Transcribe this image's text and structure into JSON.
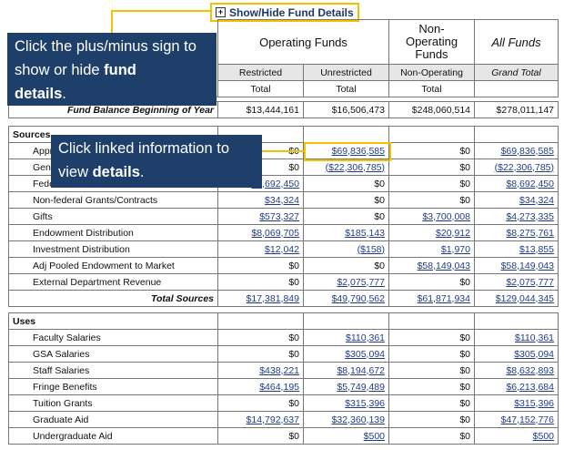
{
  "toggle": {
    "label": "Show/Hide Fund Details",
    "icon": "plus-box-icon"
  },
  "callouts": {
    "plusminus_pre": "Click the plus/minus sign to show or hide ",
    "plusminus_bold1": "fund",
    "plusminus_bold2": "details",
    "plusminus_post": ".",
    "linked_pre": "Click linked information to view ",
    "linked_bold": "details",
    "linked_post": "."
  },
  "header": {
    "operating": "Operating Funds",
    "non_operating": "Non-\nOperating\nFunds",
    "all_funds": "All Funds",
    "restricted": "Restricted",
    "unrestricted": "Unrestricted",
    "non_op_sub": "Non-Operating",
    "grand_total": "Grand Total",
    "total": "Total"
  },
  "fund_balance": {
    "label": "Fund Balance Beginning of Year",
    "values": [
      "$13,444,161",
      "$16,506,473",
      "$248,060,514",
      "$278,011,147"
    ]
  },
  "sources": {
    "title": "Sources",
    "rows": [
      {
        "label": "Appropriations",
        "values": [
          "$0",
          "$69,836,585",
          "$0",
          "$69,836,585"
        ],
        "links": [
          false,
          true,
          false,
          true
        ]
      },
      {
        "label": "General Funds",
        "values": [
          "$0",
          "($22,306,785)",
          "$0",
          "($22,306,785)"
        ],
        "links": [
          false,
          true,
          false,
          true
        ]
      },
      {
        "label": "Federal Grants/Contracts",
        "values": [
          "$8,692,450",
          "$0",
          "$0",
          "$8,692,450"
        ],
        "links": [
          true,
          false,
          false,
          true
        ]
      },
      {
        "label": "Non-federal Grants/Contracts",
        "values": [
          "$34,324",
          "$0",
          "$0",
          "$34,324"
        ],
        "links": [
          true,
          false,
          false,
          true
        ]
      },
      {
        "label": "Gifts",
        "values": [
          "$573,327",
          "$0",
          "$3,700,008",
          "$4,273,335"
        ],
        "links": [
          true,
          false,
          true,
          true
        ]
      },
      {
        "label": "Endowment Distribution",
        "values": [
          "$8,069,705",
          "$185,143",
          "$20,912",
          "$8,275,761"
        ],
        "links": [
          true,
          true,
          true,
          true
        ]
      },
      {
        "label": "Investment Distribution",
        "values": [
          "$12,042",
          "($158)",
          "$1,970",
          "$13,855"
        ],
        "links": [
          true,
          true,
          true,
          true
        ]
      },
      {
        "label": "Adj Pooled Endowment to Market",
        "values": [
          "$0",
          "$0",
          "$58,149,043",
          "$58,149,043"
        ],
        "links": [
          false,
          false,
          true,
          true
        ]
      },
      {
        "label": "External Department Revenue",
        "values": [
          "$0",
          "$2,075,777",
          "$0",
          "$2,075,777"
        ],
        "links": [
          false,
          true,
          false,
          true
        ]
      }
    ],
    "total": {
      "label": "Total Sources",
      "values": [
        "$17,381,849",
        "$49,790,562",
        "$61,871,934",
        "$129,044,345"
      ]
    }
  },
  "uses": {
    "title": "Uses",
    "rows": [
      {
        "label": "Faculty Salaries",
        "values": [
          "$0",
          "$110,361",
          "$0",
          "$110,361"
        ],
        "links": [
          false,
          true,
          false,
          true
        ]
      },
      {
        "label": "GSA Salaries",
        "values": [
          "$0",
          "$305,094",
          "$0",
          "$305,094"
        ],
        "links": [
          false,
          true,
          false,
          true
        ]
      },
      {
        "label": "Staff Salaries",
        "values": [
          "$438,221",
          "$8,194,672",
          "$0",
          "$8,632,893"
        ],
        "links": [
          true,
          true,
          false,
          true
        ]
      },
      {
        "label": "Fringe Benefits",
        "values": [
          "$464,195",
          "$5,749,489",
          "$0",
          "$6,213,684"
        ],
        "links": [
          true,
          true,
          false,
          true
        ]
      },
      {
        "label": "Tuition Grants",
        "values": [
          "$0",
          "$315,396",
          "$0",
          "$315,396"
        ],
        "links": [
          false,
          true,
          false,
          true
        ]
      },
      {
        "label": "Graduate Aid",
        "values": [
          "$14,792,637",
          "$32,360,139",
          "$0",
          "$47,152,776"
        ],
        "links": [
          true,
          true,
          false,
          true
        ]
      },
      {
        "label": "Undergraduate Aid",
        "values": [
          "$0",
          "$500",
          "$0",
          "$500"
        ],
        "links": [
          false,
          true,
          false,
          true
        ]
      }
    ]
  },
  "colors": {
    "callout_bg": "#1f3f6b",
    "highlight": "#f2c200",
    "link": "#1f3c8a"
  }
}
